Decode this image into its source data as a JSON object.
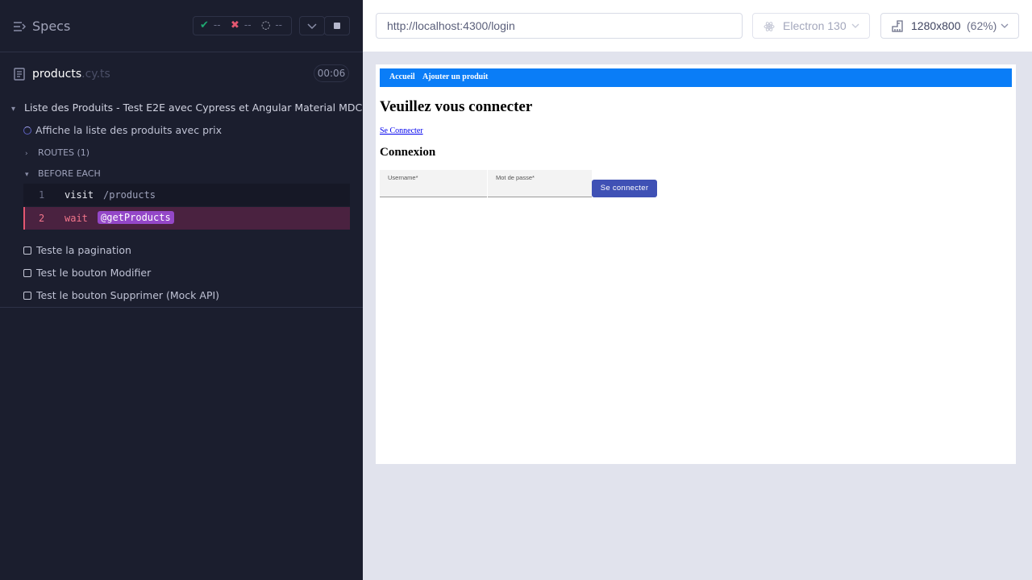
{
  "runner": {
    "specs_title": "Specs",
    "stats": {
      "passed": "--",
      "failed": "--",
      "pending": "--"
    },
    "spec": {
      "name": "products",
      "ext": ".cy.ts",
      "duration": "00:06"
    },
    "suite_title": "Liste des Produits - Test E2E avec Cypress et Angular Material MDC",
    "running_test": "Affiche la liste des produits avec prix",
    "routes_label": "ROUTES (1)",
    "before_each_label": "BEFORE EACH",
    "commands": [
      {
        "num": "1",
        "name": "visit",
        "arg": "/products"
      },
      {
        "num": "2",
        "name": "wait",
        "arg": "@getProducts"
      }
    ],
    "tests": [
      "Teste la pagination",
      "Test le bouton Modifier",
      "Test le bouton Supprimer (Mock API)"
    ]
  },
  "browser_bar": {
    "url": "http://localhost:4300/login",
    "browser": "Electron 130",
    "viewport": "1280x800",
    "zoom": "(62%)"
  },
  "app": {
    "nav": [
      "Accueil",
      "Ajouter un produit"
    ],
    "heading": "Veuillez vous connecter",
    "login_link": "Se Connecter",
    "subheading": "Connexion",
    "username_label": "Username*",
    "password_label": "Mot de passe*",
    "submit": "Se connecter"
  },
  "colors": {
    "sidebar_bg": "#1b1e2e",
    "navbar": "#0a7df7",
    "primary_button": "#3f51b5",
    "failed_command": "#4a2240",
    "alias": "#9447c8"
  }
}
